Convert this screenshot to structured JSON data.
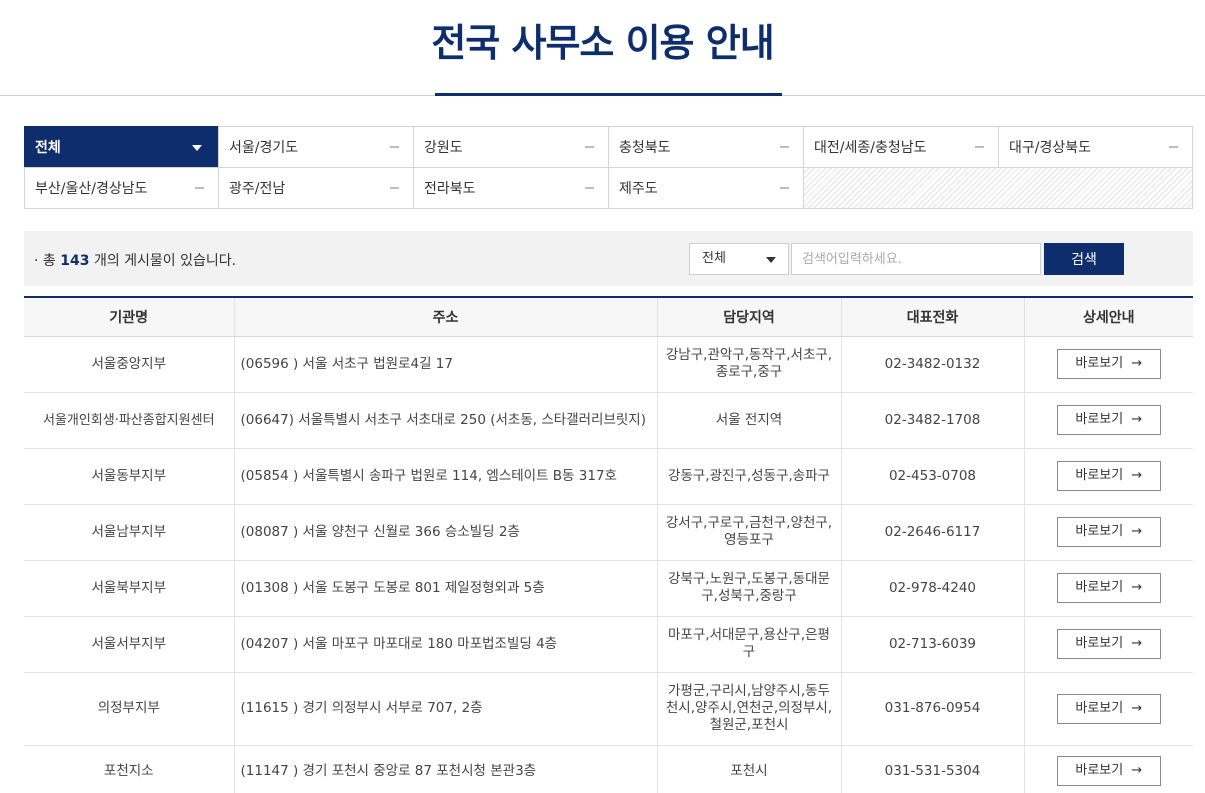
{
  "header": {
    "title": "전국 사무소 이용 안내"
  },
  "tabs": [
    {
      "label": "전체",
      "active": true
    },
    {
      "label": "서울/경기도",
      "active": false
    },
    {
      "label": "강원도",
      "active": false
    },
    {
      "label": "충청북도",
      "active": false
    },
    {
      "label": "대전/세종/충청남도",
      "active": false
    },
    {
      "label": "대구/경상북도",
      "active": false
    },
    {
      "label": "부산/울산/경상남도",
      "active": false
    },
    {
      "label": "광주/전남",
      "active": false
    },
    {
      "label": "전라북도",
      "active": false
    },
    {
      "label": "제주도",
      "active": false
    }
  ],
  "search": {
    "count_prefix": "총",
    "count": "143",
    "count_suffix": "개의 게시물이 있습니다.",
    "select_value": "전체",
    "placeholder": "검색어입력하세요.",
    "button_label": "검색"
  },
  "table": {
    "headers": [
      "기관명",
      "주소",
      "담당지역",
      "대표전화",
      "상세안내"
    ],
    "rows": [
      {
        "name": "서울중앙지부",
        "address": "(06596 ) 서울 서초구 법원로4길 17",
        "area": "강남구,관악구,동작구,서초구,종로구,중구",
        "phone": "02-3482-0132",
        "detail": "바로보기"
      },
      {
        "name": "서울개인회생·파산종합지원센터",
        "address": "(06647) 서울특별시 서초구 서초대로 250 (서초동, 스타갤러리브릿지)",
        "area": "서울 전지역",
        "phone": "02-3482-1708",
        "detail": "바로보기"
      },
      {
        "name": "서울동부지부",
        "address": "(05854 ) 서울특별시 송파구 법원로 114, 엠스테이트 B동 317호",
        "area": "강동구,광진구,성동구,송파구",
        "phone": "02-453-0708",
        "detail": "바로보기"
      },
      {
        "name": "서울남부지부",
        "address": "(08087 ) 서울 양천구 신월로 366 승소빌딩 2층",
        "area": "강서구,구로구,금천구,양천구,영등포구",
        "phone": "02-2646-6117",
        "detail": "바로보기"
      },
      {
        "name": "서울북부지부",
        "address": "(01308 ) 서울 도봉구 도봉로 801 제일정형외과 5층",
        "area": "강북구,노원구,도봉구,동대문구,성북구,중랑구",
        "phone": "02-978-4240",
        "detail": "바로보기"
      },
      {
        "name": "서울서부지부",
        "address": "(04207 ) 서울 마포구 마포대로 180 마포법조빌딩 4층",
        "area": "마포구,서대문구,용산구,은평구",
        "phone": "02-713-6039",
        "detail": "바로보기"
      },
      {
        "name": "의정부지부",
        "address": "(11615 ) 경기 의정부시 서부로 707, 2층",
        "area": "가평군,구리시,남양주시,동두천시,양주시,연천군,의정부시,철원군,포천시",
        "phone": "031-876-0954",
        "detail": "바로보기"
      },
      {
        "name": "포천지소",
        "address": "(11147 ) 경기 포천시 중앙로 87 포천시청 본관3층",
        "area": "포천시",
        "phone": "031-531-5304",
        "detail": "바로보기"
      }
    ]
  },
  "colors": {
    "brand": "#0d2d6c",
    "header_bg": "#f7f7f7",
    "search_bg": "#f2f2f2"
  },
  "icons": {
    "tab_active": "caret-down-icon",
    "tab_inactive": "dash-icon",
    "view": "arrow-right-icon"
  }
}
